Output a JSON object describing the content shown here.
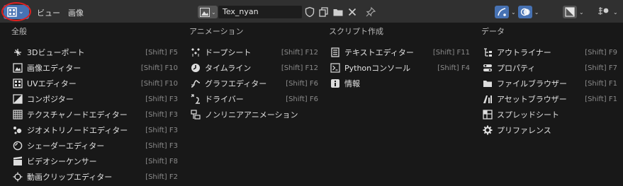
{
  "header": {
    "menu_view": "ビュー",
    "menu_image": "画像",
    "image_name": "Tex_nyan"
  },
  "columns": [
    {
      "title": "全般",
      "items": [
        {
          "label": "3Dビューポート",
          "shortcut": "[Shift] F5",
          "icon": "viewport-3d-icon"
        },
        {
          "label": "画像エディター",
          "shortcut": "[Shift] F10",
          "icon": "image-editor-icon"
        },
        {
          "label": "UVエディター",
          "shortcut": "[Shift] F10",
          "icon": "uv-editor-icon"
        },
        {
          "label": "コンポジター",
          "shortcut": "[Shift] F3",
          "icon": "compositor-icon"
        },
        {
          "label": "テクスチャノードエディター",
          "shortcut": "[Shift] F3",
          "icon": "texture-node-icon"
        },
        {
          "label": "ジオメトリノードエディター",
          "shortcut": "[Shift] F3",
          "icon": "geometry-node-icon"
        },
        {
          "label": "シェーダーエディター",
          "shortcut": "[Shift] F3",
          "icon": "shader-editor-icon"
        },
        {
          "label": "ビデオシーケンサー",
          "shortcut": "[Shift] F8",
          "icon": "video-sequencer-icon"
        },
        {
          "label": "動画クリップエディター",
          "shortcut": "[Shift] F2",
          "icon": "movie-clip-icon"
        }
      ]
    },
    {
      "title": "アニメーション",
      "items": [
        {
          "label": "ドープシート",
          "shortcut": "[Shift] F12",
          "icon": "dopesheet-icon"
        },
        {
          "label": "タイムライン",
          "shortcut": "[Shift] F12",
          "icon": "timeline-icon"
        },
        {
          "label": "グラフエディター",
          "shortcut": "[Shift] F6",
          "icon": "graph-editor-icon"
        },
        {
          "label": "ドライバー",
          "shortcut": "[Shift] F6",
          "icon": "drivers-icon"
        },
        {
          "label": "ノンリニアアニメーション",
          "shortcut": "",
          "icon": "nla-icon"
        }
      ]
    },
    {
      "title": "スクリプト作成",
      "items": [
        {
          "label": "テキストエディター",
          "shortcut": "[Shift] F11",
          "icon": "text-editor-icon"
        },
        {
          "label": "Pythonコンソール",
          "shortcut": "[Shift] F4",
          "icon": "console-icon"
        },
        {
          "label": "情報",
          "shortcut": "",
          "icon": "info-icon"
        }
      ]
    },
    {
      "title": "データ",
      "items": [
        {
          "label": "アウトライナー",
          "shortcut": "[Shift] F9",
          "icon": "outliner-icon"
        },
        {
          "label": "プロパティ",
          "shortcut": "[Shift] F7",
          "icon": "properties-icon"
        },
        {
          "label": "ファイルブラウザー",
          "shortcut": "[Shift] F1",
          "icon": "file-browser-icon"
        },
        {
          "label": "アセットブラウザー",
          "shortcut": "[Shift] F1",
          "icon": "asset-browser-icon"
        },
        {
          "label": "スプレッドシート",
          "shortcut": "",
          "icon": "spreadsheet-icon"
        },
        {
          "label": "プリファレンス",
          "shortcut": "",
          "icon": "preferences-icon"
        }
      ]
    }
  ],
  "colors": {
    "header_bg": "#303030",
    "panel_bg": "#181818",
    "accent_blue": "#4772b3",
    "highlight_ring": "#e02020"
  }
}
